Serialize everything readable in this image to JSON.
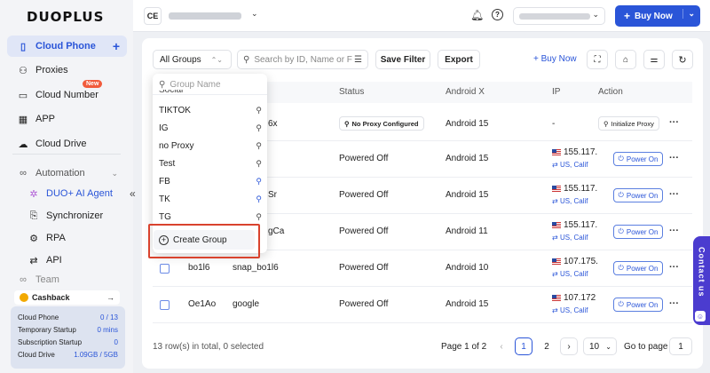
{
  "app": {
    "logo": "DUOPLUS"
  },
  "sidebar": {
    "items": [
      {
        "label": "Cloud Phone",
        "icon": "phone-icon"
      },
      {
        "label": "Proxies",
        "icon": "proxies-icon"
      },
      {
        "label": "Cloud Number",
        "icon": "number-icon",
        "badge": "New"
      },
      {
        "label": "APP",
        "icon": "app-grid-icon"
      },
      {
        "label": "Cloud Drive",
        "icon": "cloud-icon"
      }
    ],
    "automation": {
      "label": "Automation",
      "items": [
        {
          "label": "DUO+ AI Agent"
        },
        {
          "label": "Synchronizer"
        },
        {
          "label": "RPA"
        },
        {
          "label": "API"
        }
      ]
    },
    "team_label": "Team",
    "cashback": "Cashback",
    "usage": [
      {
        "label": "Cloud Phone",
        "value": "0 / 13"
      },
      {
        "label": "Temporary Startup",
        "value": "0 mins"
      },
      {
        "label": "Subscription Startup",
        "value": "0"
      },
      {
        "label": "Cloud Drive",
        "value": "1.09GB / 5GB"
      }
    ]
  },
  "header": {
    "account_initials": "CE",
    "buy_now": "Buy Now"
  },
  "toolbar": {
    "group_select": "All Groups",
    "search_placeholder": "Search by ID, Name or F",
    "save_filter": "Save Filter",
    "export": "Export",
    "buy_now": "Buy Now"
  },
  "table": {
    "headers": [
      "Status",
      "Android X",
      "IP",
      "Action"
    ],
    "rows": [
      {
        "id": "",
        "name": "6x",
        "status": "No Proxy Configured",
        "android": "Android 15",
        "ip": "-",
        "action": "Initialize Proxy"
      },
      {
        "id": "",
        "name": "",
        "status": "Powered Off",
        "android": "Android 15",
        "ip": "155.117.",
        "loc": "US, Calif",
        "action": "Power On"
      },
      {
        "id": "",
        "name": "Sr",
        "status": "Powered Off",
        "android": "Android 15",
        "ip": "155.117.",
        "loc": "US, Calif",
        "action": "Power On"
      },
      {
        "id": "",
        "name": "gCa",
        "status": "Powered Off",
        "android": "Android 11",
        "ip": "155.117.",
        "loc": "US, Calif",
        "action": "Power On"
      },
      {
        "id": "bo1l6",
        "name": "snap_bo1l6",
        "status": "Powered Off",
        "android": "Android 10",
        "ip": "107.175.",
        "loc": "US, Calif",
        "action": "Power On"
      },
      {
        "id": "Oe1Ao",
        "name": "google",
        "status": "Powered Off",
        "android": "Android 15",
        "ip": "107.172",
        "loc": "US, Calif",
        "action": "Power On"
      }
    ]
  },
  "dropdown": {
    "search_placeholder": "Group Name",
    "partial_item": "Social",
    "items": [
      {
        "label": "TIKTOK",
        "pinned": false
      },
      {
        "label": "IG",
        "pinned": false
      },
      {
        "label": "no Proxy",
        "pinned": false
      },
      {
        "label": "Test",
        "pinned": false
      },
      {
        "label": "FB",
        "pinned": true
      },
      {
        "label": "TK",
        "pinned": true
      },
      {
        "label": "TG",
        "pinned": false
      }
    ],
    "create_group": "Create Group"
  },
  "footer": {
    "summary": "13 row(s) in total, 0 selected",
    "page_info": "Page 1 of 2",
    "pages": [
      "1",
      "2"
    ],
    "page_size": "10",
    "goto_label": "Go to page",
    "goto_value": "1"
  },
  "contact": "Contact us",
  "colors": {
    "accent": "#2a55d8",
    "highlight": "#d9432e",
    "contact": "#4b3ccf"
  }
}
